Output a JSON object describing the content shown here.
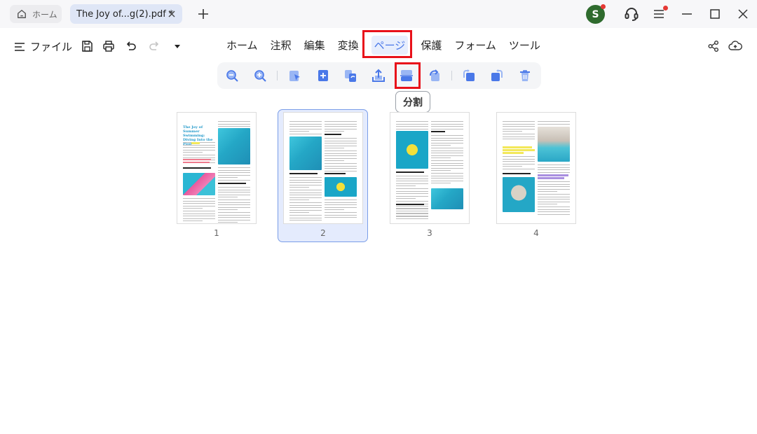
{
  "titlebar": {
    "home_tab": "ホーム",
    "document_tab": "The Joy of...g(2).pdf *",
    "avatar_initial": "S"
  },
  "menubar": {
    "file_label": "ファイル",
    "tabs": [
      "ホーム",
      "注釈",
      "編集",
      "変換",
      "ページ",
      "保護",
      "フォーム",
      "ツール"
    ],
    "active_tab": "ページ"
  },
  "toolbar": {
    "icons": [
      "zoom-out-icon",
      "zoom-in-icon",
      "extract-pointer-icon",
      "insert-page-icon",
      "replace-page-icon",
      "export-page-icon",
      "split-page-icon",
      "rotate-left-icon",
      "rotate-page-left-icon",
      "rotate-page-right-icon",
      "delete-page-icon"
    ],
    "tooltip": "分割"
  },
  "pages": {
    "labels": [
      "1",
      "2",
      "3",
      "4"
    ],
    "selected": "2",
    "page1_title": "The Joy of Summer Swimming: Diving Into the Pool"
  },
  "colors": {
    "accent": "#4a78e8",
    "highlight_box": "#e8111a",
    "avatar": "#2f6b2e",
    "selected_page_bg": "#e4ebfd"
  }
}
